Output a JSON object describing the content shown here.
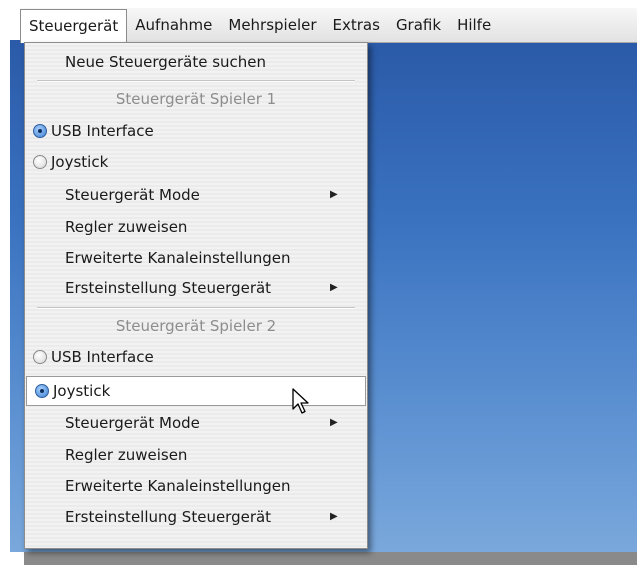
{
  "menubar": {
    "items": [
      "Steuergerät",
      "Aufnahme",
      "Mehrspieler",
      "Extras",
      "Grafik",
      "Hilfe"
    ]
  },
  "dropdown": {
    "search": "Neue Steuergeräte suchen",
    "player1": {
      "header": "Steuergerät Spieler 1",
      "usb": "USB Interface",
      "joystick": "Joystick",
      "mode": "Steuergerät Mode",
      "assign": "Regler zuweisen",
      "advanced": "Erweiterte Kanaleinstellungen",
      "initial": "Ersteinstellung Steuergerät"
    },
    "player2": {
      "header": "Steuergerät Spieler 2",
      "usb": "USB Interface",
      "joystick": "Joystick",
      "mode": "Steuergerät Mode",
      "assign": "Regler zuweisen",
      "advanced": "Erweiterte Kanaleinstellungen",
      "initial": "Ersteinstellung Steuergerät"
    }
  },
  "icons": {
    "submenu": "triangle-right-icon",
    "cursor": "mouse-pointer-icon",
    "radio": "radio-button-icon"
  },
  "colors": {
    "desktop": "#3a72c0",
    "menu_bg": "#efefef",
    "disabled_text": "#8d8d8d",
    "radio_selected": "#3a7fd0"
  }
}
